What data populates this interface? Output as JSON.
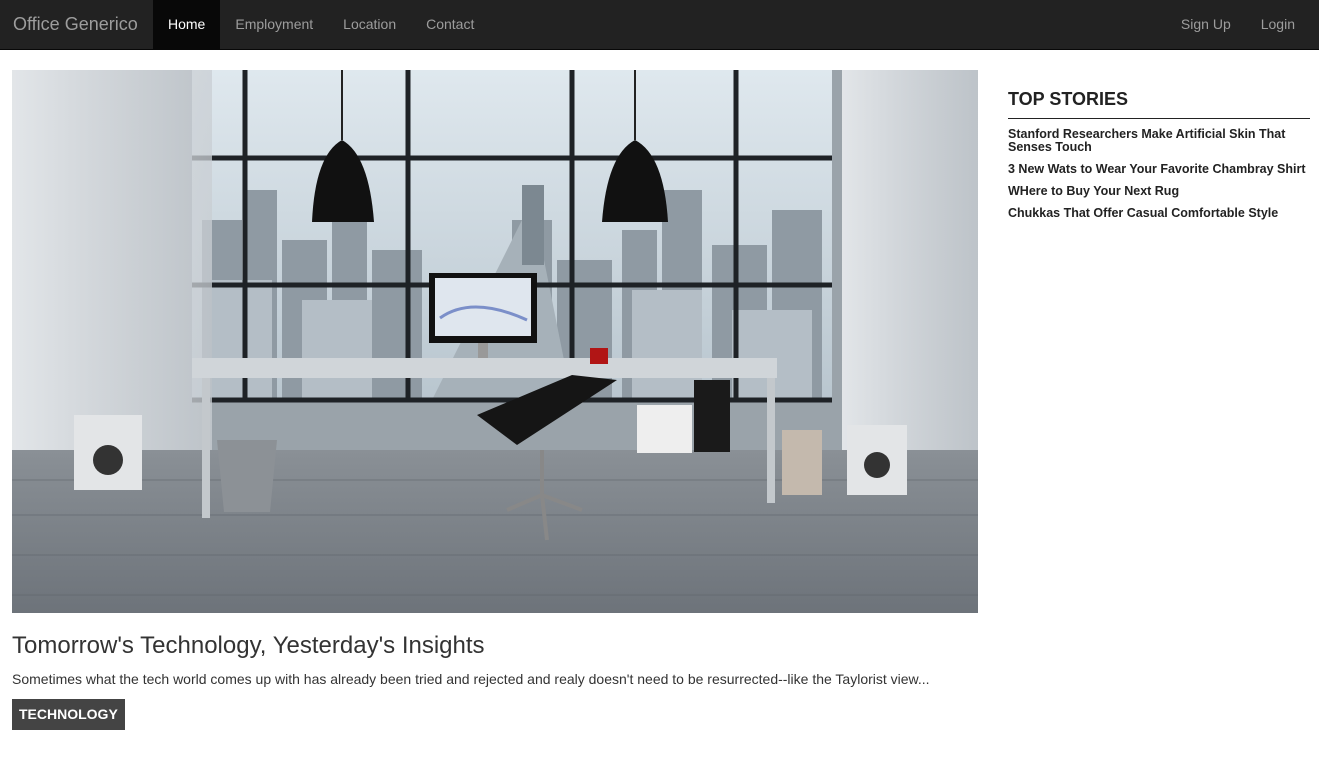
{
  "navbar": {
    "brand": "Office Generico",
    "left_items": [
      {
        "label": "Home",
        "active": true
      },
      {
        "label": "Employment",
        "active": false
      },
      {
        "label": "Location",
        "active": false
      },
      {
        "label": "Contact",
        "active": false
      }
    ],
    "right_items": [
      {
        "label": "Sign Up"
      },
      {
        "label": "Login"
      }
    ]
  },
  "hero": {
    "description": "photo"
  },
  "article": {
    "title": "Tomorrow's Technology, Yesterday's Insights",
    "excerpt": "Sometimes what the tech world comes up with has already been tried and rejected and realy doesn't need to be resurrected--like the Taylorist view...",
    "tag": "TECHNOLOGY"
  },
  "sidebar": {
    "title": "TOP STORIES",
    "stories": [
      "Stanford Researchers Make Artificial Skin That Senses Touch",
      "3 New Wats to Wear Your Favorite Chambray Shirt",
      "WHere to Buy Your Next Rug",
      "Chukkas That Offer Casual Comfortable Style"
    ]
  },
  "colors": {
    "navbar_bg": "#222222",
    "navbar_active_bg": "#080808",
    "nav_text": "#9d9d9d",
    "tag_bg": "#444444"
  }
}
